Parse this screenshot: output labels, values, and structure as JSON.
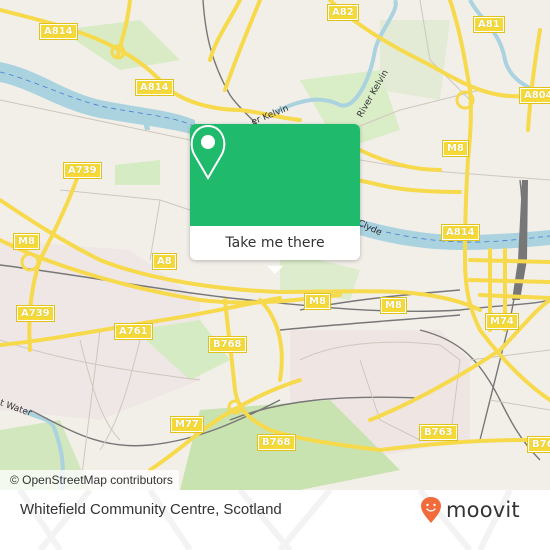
{
  "map": {
    "road_labels": [
      {
        "id": "a814-nw",
        "text": "A814"
      },
      {
        "id": "a814-w",
        "text": "A814"
      },
      {
        "id": "a82",
        "text": "A82"
      },
      {
        "id": "a81",
        "text": "A81"
      },
      {
        "id": "a804",
        "text": "A804"
      },
      {
        "id": "a739-n",
        "text": "A739"
      },
      {
        "id": "m8-w",
        "text": "M8"
      },
      {
        "id": "a8",
        "text": "A8"
      },
      {
        "id": "m8-ne",
        "text": "M8"
      },
      {
        "id": "a814-e",
        "text": "A814"
      },
      {
        "id": "a739-s",
        "text": "A739"
      },
      {
        "id": "a761",
        "text": "A761"
      },
      {
        "id": "m8-c1",
        "text": "M8"
      },
      {
        "id": "m8-c2",
        "text": "M8"
      },
      {
        "id": "m74",
        "text": "M74"
      },
      {
        "id": "b768-n",
        "text": "B768"
      },
      {
        "id": "m77",
        "text": "M77"
      },
      {
        "id": "b768-s",
        "text": "B768"
      },
      {
        "id": "b763",
        "text": "B763"
      },
      {
        "id": "b76x",
        "text": "B76"
      }
    ],
    "water_labels": [
      {
        "id": "river-kelvin-1",
        "text": "er Kelvin"
      },
      {
        "id": "river-kelvin-2",
        "text": "River Kelvin"
      },
      {
        "id": "river-clyde",
        "text": "Clyde"
      },
      {
        "id": "white-cart-water",
        "text": "t Water"
      }
    ],
    "attribution": "© OpenStreetMap contributors"
  },
  "popup": {
    "button_label": "Take me there",
    "icon": "location-pin-icon",
    "accent_color": "#1fba6b"
  },
  "footer": {
    "place_name": "Whitefield Community Centre, Scotland",
    "brand_name": "moovit",
    "brand_color": "#f26b3a"
  }
}
